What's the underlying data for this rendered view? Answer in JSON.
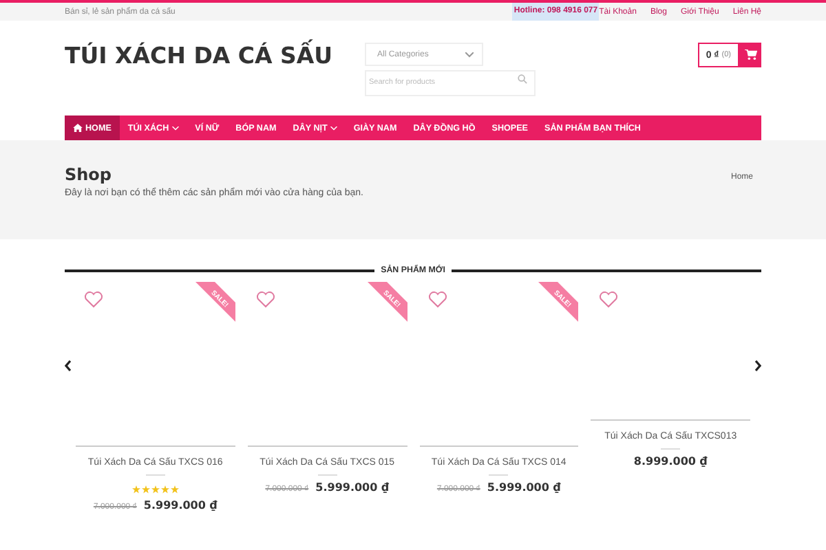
{
  "topbar": {
    "tagline": "Bán sỉ, lẻ sản phẩm da cá sấu",
    "hotline": "Hotline: 098 4916 077",
    "links": [
      "Tài Khoản",
      "Blog",
      "Giới Thiệu",
      "Liên Hệ"
    ]
  },
  "header": {
    "logo": "TÚI XÁCH DA CÁ SẤU",
    "category_select": "All Categories",
    "search": {
      "placeholder": "Search for products"
    },
    "cart": {
      "total": "0 ₫",
      "count": "(0)"
    }
  },
  "nav": [
    {
      "label": "HOME",
      "selected": true,
      "dropdown": false,
      "home_icon": true
    },
    {
      "label": "TÚI XÁCH",
      "selected": false,
      "dropdown": true
    },
    {
      "label": "VÍ NỮ",
      "selected": false,
      "dropdown": false
    },
    {
      "label": "BÓP NAM",
      "selected": false,
      "dropdown": false
    },
    {
      "label": "DÂY NỊT",
      "selected": false,
      "dropdown": true
    },
    {
      "label": "GIÀY NAM",
      "selected": false,
      "dropdown": false
    },
    {
      "label": "DÂY ĐỒNG HỒ",
      "selected": false,
      "dropdown": false
    },
    {
      "label": "SHOPEE",
      "selected": false,
      "dropdown": false
    },
    {
      "label": "SẢN PHẨM BẠN THÍCH",
      "selected": false,
      "dropdown": false
    }
  ],
  "page": {
    "title": "Shop",
    "description": "Đây là nơi bạn có thể thêm các sản phẩm mới vào cửa hàng của bạn.",
    "breadcrumb": "Home"
  },
  "section_title": "SẢN PHẨM MỚI",
  "products": [
    {
      "name": "Túi Xách Da Cá Sấu TXCS 016",
      "sale_badge": "SALE!",
      "stars": 5,
      "old_price": "7.000.000 ₫",
      "price": "5.999.000 ₫"
    },
    {
      "name": "Túi Xách Da Cá Sấu TXCS 015",
      "sale_badge": "SALE!",
      "old_price": "7.000.000 ₫",
      "price": "5.999.000 ₫"
    },
    {
      "name": "Túi Xách Da Cá Sấu TXCS 014",
      "sale_badge": "SALE!",
      "old_price": "7.000.000 ₫",
      "price": "5.999.000 ₫"
    },
    {
      "name": "Túi Xách Da Cá Sấu TXCS013",
      "price": "8.999.000 ₫"
    }
  ]
}
